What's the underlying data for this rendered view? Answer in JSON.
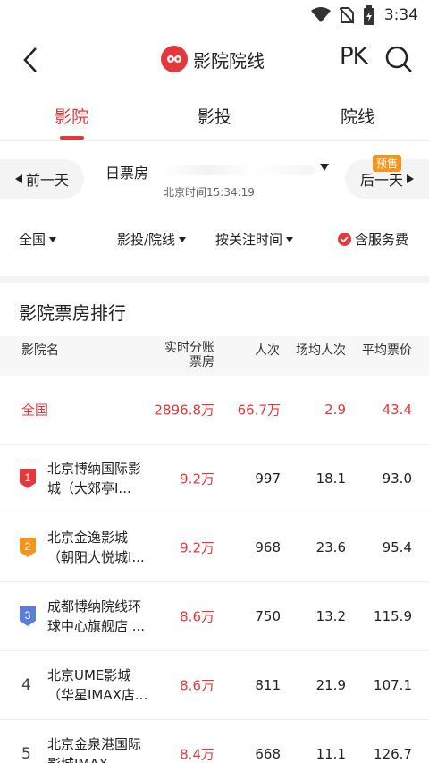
{
  "status": {
    "time": "3:34"
  },
  "header": {
    "title": "影院院线",
    "pk_label": "PK"
  },
  "tabs": [
    {
      "label": "影院"
    },
    {
      "label": "影投"
    },
    {
      "label": "院线"
    }
  ],
  "date_bar": {
    "prev_label": "前一天",
    "next_label": "后一天",
    "presale_badge": "预售",
    "title": "日票房",
    "beijing_time": "北京时间15:34:19"
  },
  "filters": {
    "region": "全国",
    "investor": "影投/院线",
    "sort": "按关注时间",
    "service_fee": "含服务费"
  },
  "section": {
    "title": "影院票房排行"
  },
  "table": {
    "headers": {
      "name": "影院名",
      "box_office": "实时分账\n票房",
      "admissions": "人次",
      "avg_per_show": "场均人次",
      "avg_price": "平均票价"
    },
    "total": {
      "name": "全国",
      "box_office": "2896.8万",
      "admissions": "66.7万",
      "avg_per_show": "2.9",
      "avg_price": "43.4"
    },
    "rows": [
      {
        "rank": "1",
        "name": "北京博纳国际影城（大郊亭I...",
        "box_office": "9.2万",
        "admissions": "997",
        "avg_per_show": "18.1",
        "avg_price": "93.0",
        "badge_color": "#e4393c"
      },
      {
        "rank": "2",
        "name": "北京金逸影城（朝阳大悦城I...",
        "box_office": "9.2万",
        "admissions": "968",
        "avg_per_show": "23.6",
        "avg_price": "95.4",
        "badge_color": "#f7941d"
      },
      {
        "rank": "3",
        "name": "成都博纳院线环球中心旗舰店 ...",
        "box_office": "8.6万",
        "admissions": "750",
        "avg_per_show": "13.2",
        "avg_price": "115.9",
        "badge_color": "#5b7fd6"
      },
      {
        "rank": "4",
        "name": "北京UME影城（华星IMAX店...",
        "box_office": "8.6万",
        "admissions": "811",
        "avg_per_show": "21.9",
        "avg_price": "107.1"
      },
      {
        "rank": "5",
        "name": "北京金泉港国际影城IMAX...",
        "box_office": "8.4万",
        "admissions": "668",
        "avg_per_show": "11.1",
        "avg_price": "126.7"
      }
    ]
  },
  "colors": {
    "accent": "#e4393c",
    "rank2": "#f7941d",
    "rank3": "#5b7fd6"
  }
}
